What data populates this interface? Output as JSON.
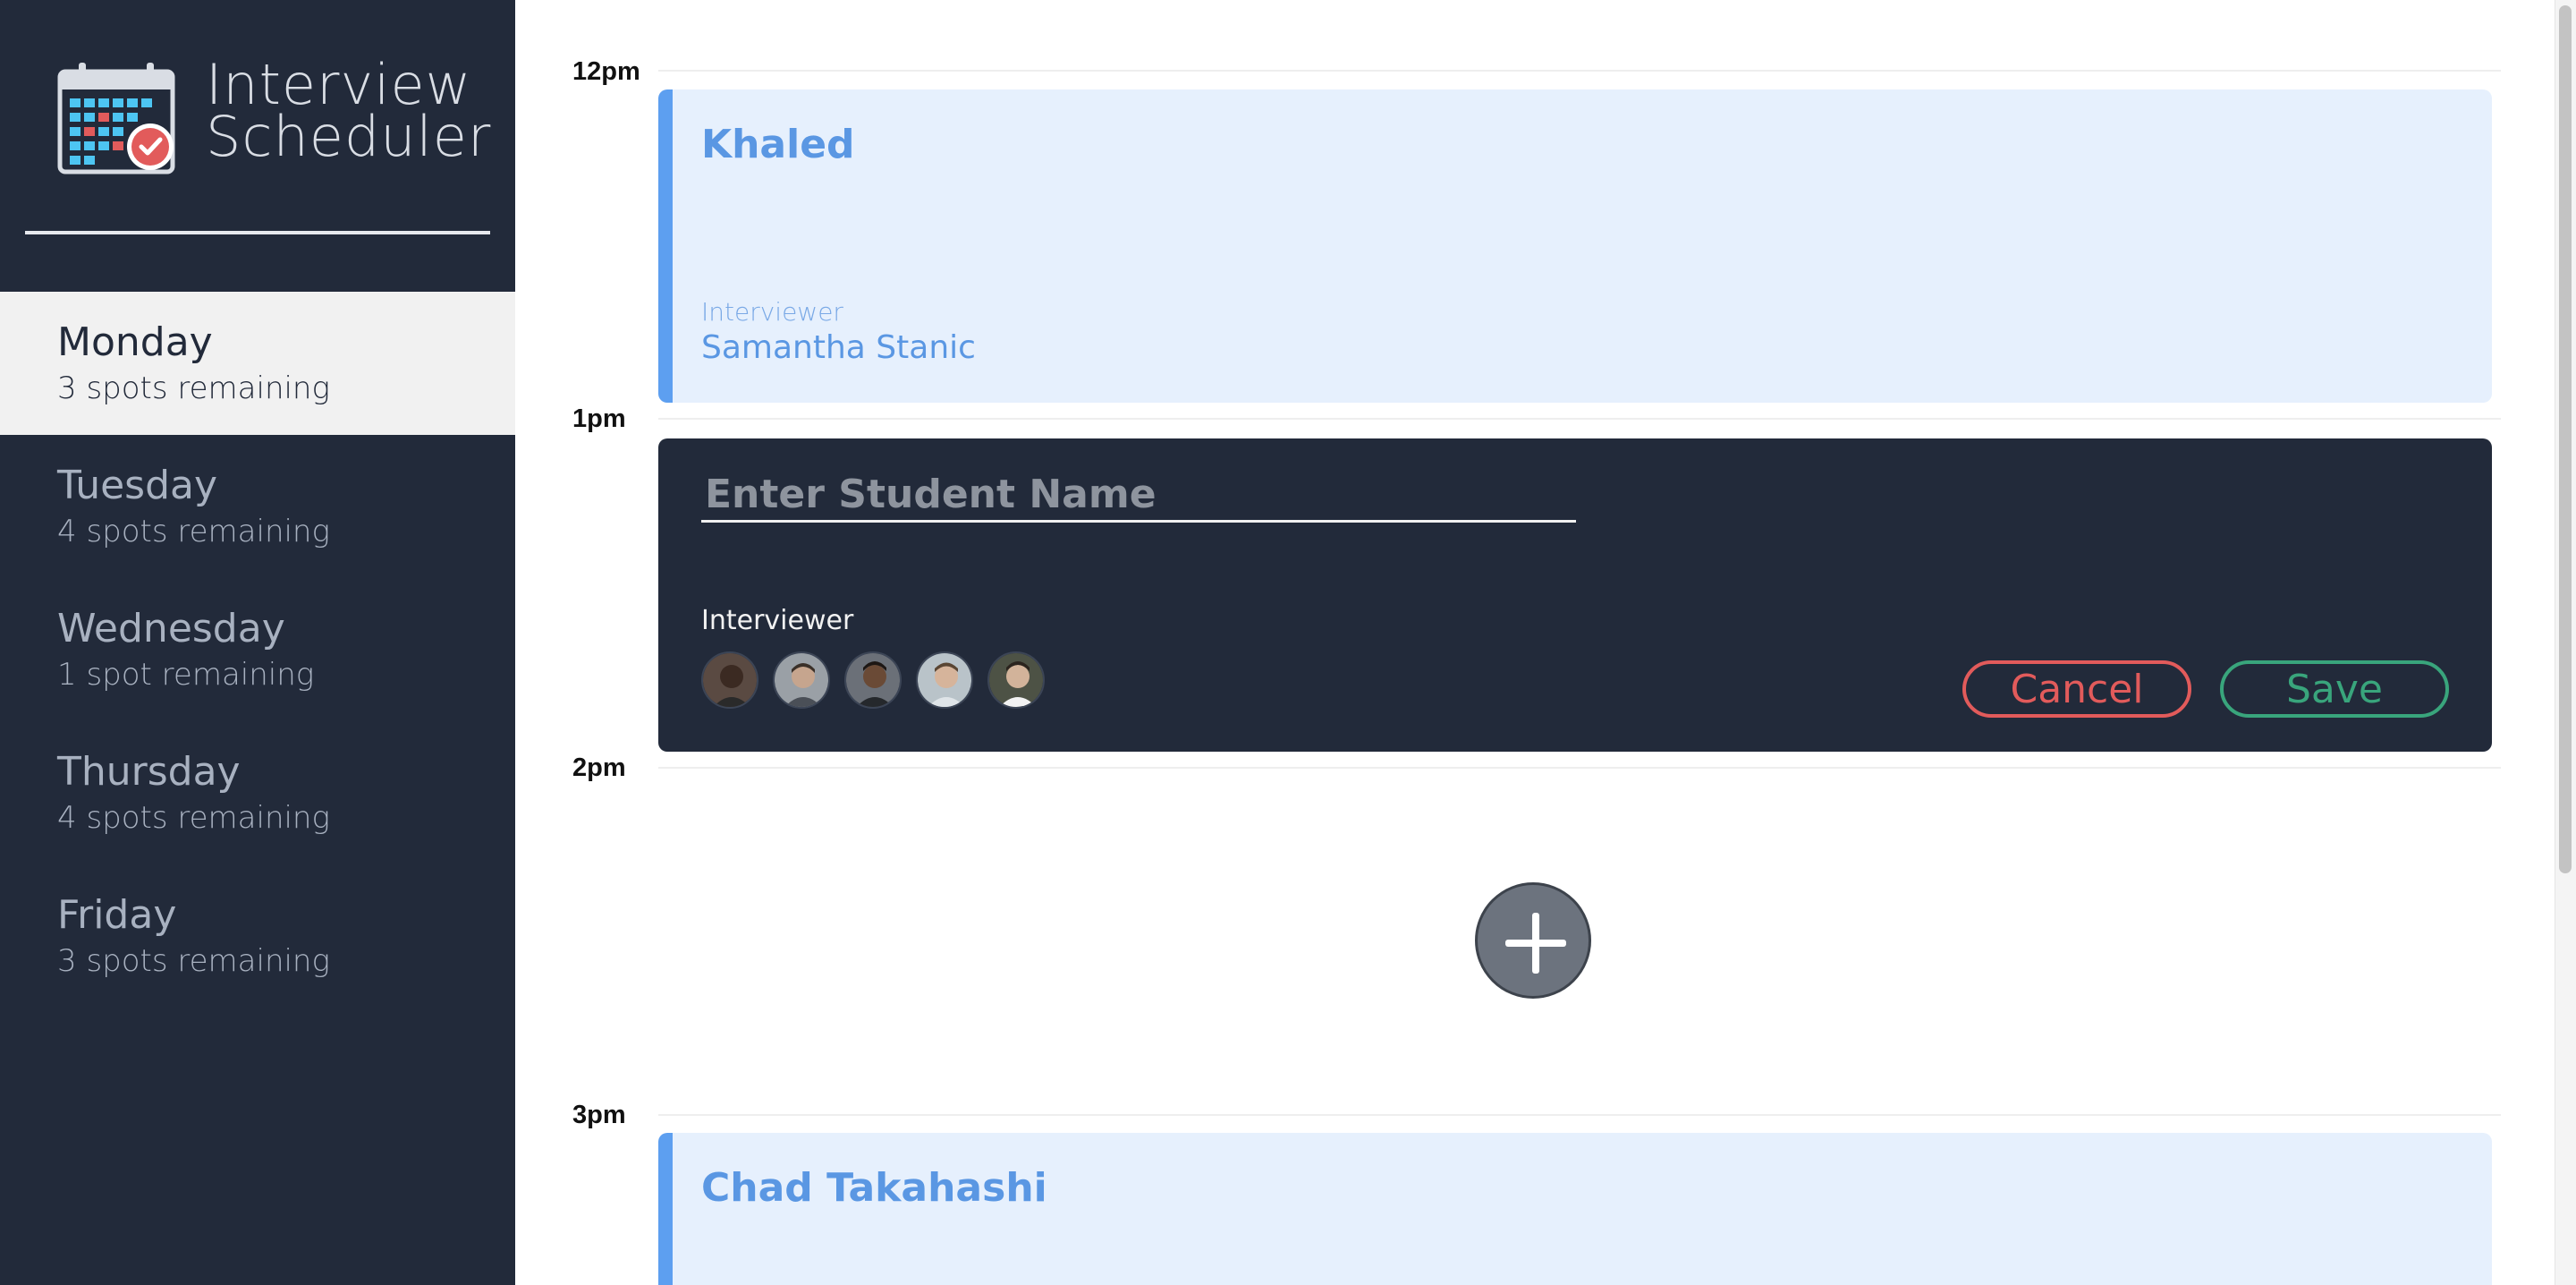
{
  "app": {
    "title_line1": "Interview",
    "title_line2": "Scheduler"
  },
  "sidebar": {
    "days": [
      {
        "name": "Monday",
        "spots": "3 spots remaining",
        "selected": true
      },
      {
        "name": "Tuesday",
        "spots": "4 spots remaining",
        "selected": false
      },
      {
        "name": "Wednesday",
        "spots": "1 spot remaining",
        "selected": false
      },
      {
        "name": "Thursday",
        "spots": "4 spots remaining",
        "selected": false
      },
      {
        "name": "Friday",
        "spots": "3 spots remaining",
        "selected": false
      }
    ]
  },
  "schedule": {
    "times": [
      "12pm",
      "1pm",
      "2pm",
      "3pm"
    ],
    "appointments": [
      {
        "student": "Khaled",
        "interviewer_label": "Interviewer",
        "interviewer": "Samantha Stanic"
      },
      {
        "student": "Chad Takahashi"
      }
    ],
    "form": {
      "student_placeholder": "Enter Student Name",
      "student_value": "",
      "interviewer_label": "Interviewer",
      "interviewers": [
        "interviewer-1",
        "interviewer-2",
        "interviewer-3",
        "interviewer-4",
        "interviewer-5"
      ],
      "cancel_label": "Cancel",
      "save_label": "Save"
    },
    "add_icon": "plus-icon"
  },
  "colors": {
    "sidebar_bg": "#222a3a",
    "selected_bg": "#f1f1f1",
    "appointment_bg": "#e6f0fd",
    "appointment_accent": "#5d9ff0",
    "cancel": "#e25b5b",
    "save": "#39a57c",
    "add_button": "#6c737e"
  }
}
